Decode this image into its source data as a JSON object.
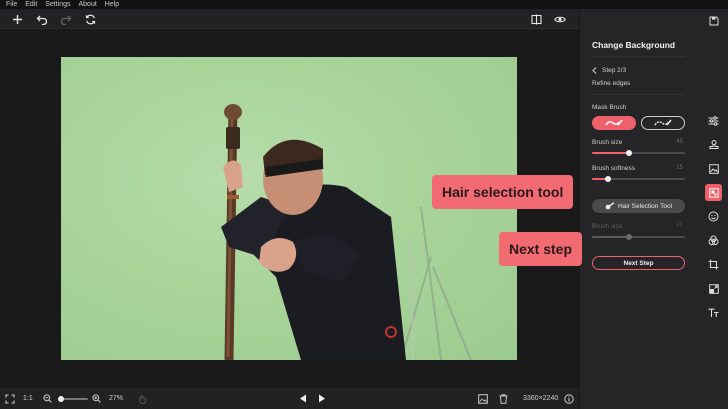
{
  "menu": {
    "file": "File",
    "edit": "Edit",
    "settings": "Settings",
    "about": "About",
    "help": "Help"
  },
  "panel": {
    "title": "Change Background",
    "step": "Step 2/3",
    "subtitle": "Refine edges",
    "mask_brush_label": "Mask Brush",
    "brush_size_label": "Brush size",
    "brush_size_value": "45",
    "brush_size_level": 0.4,
    "brush_softness_label": "Brush softness",
    "brush_softness_value": "15",
    "brush_softness_level": 0.17,
    "hair_button": "Hair Selection Tool",
    "hair_size_label": "Brush size",
    "hair_size_value": "45",
    "hair_size_level": 0.4,
    "next_button": "Next Step"
  },
  "callouts": {
    "hair": "Hair selection tool",
    "next": "Next step"
  },
  "bottom": {
    "ratio": "1:1",
    "zoom": "27%",
    "dimensions": "3360×2240",
    "zoom_level": 0.1
  },
  "icons": {
    "accent": "#f0606b",
    "toolbar": [
      "plus-icon",
      "undo-icon",
      "redo-icon",
      "sync-icon",
      "compare-icon",
      "eye-icon",
      "save-icon"
    ],
    "rail": [
      "adjust-icon",
      "stamp-icon",
      "image-icon",
      "background-icon",
      "face-icon",
      "color-icon",
      "crop-icon",
      "resize-icon",
      "text-icon"
    ]
  }
}
